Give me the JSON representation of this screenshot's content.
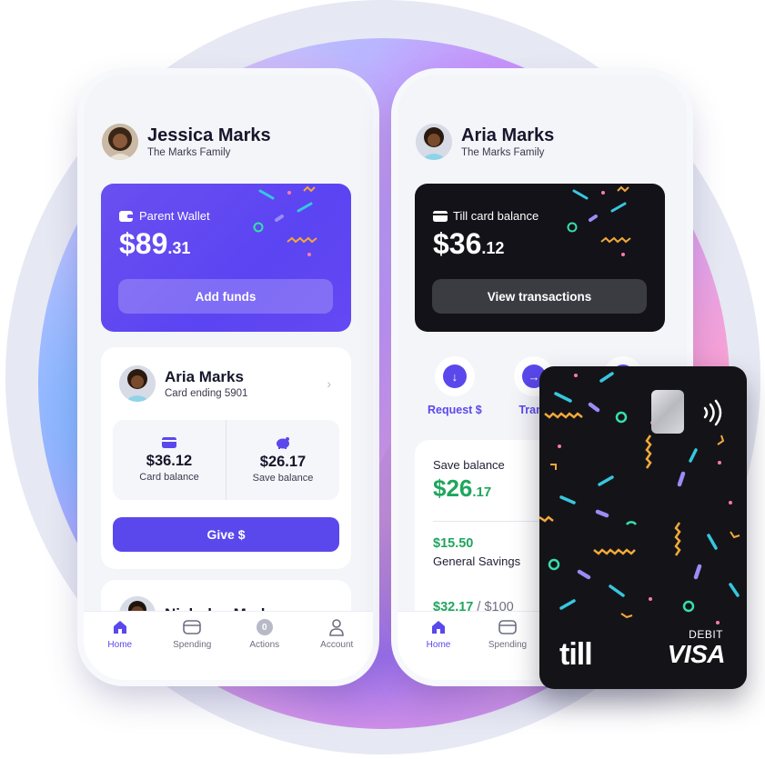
{
  "left_phone": {
    "profile": {
      "name": "Jessica Marks",
      "family": "The Marks Family"
    },
    "wallet": {
      "label": "Parent Wallet",
      "amount_whole": "$89",
      "amount_cents": ".31",
      "button": "Add funds"
    },
    "child": {
      "name": "Aria Marks",
      "subtitle": "Card ending 5901",
      "card_balance_value": "$36.12",
      "card_balance_label": "Card balance",
      "save_balance_value": "$26.17",
      "save_balance_label": "Save balance",
      "button": "Give $"
    },
    "next_child": {
      "name": "Nicholas Marks"
    },
    "tabs": [
      {
        "label": "Home",
        "icon": "home-icon"
      },
      {
        "label": "Spending",
        "icon": "card-icon"
      },
      {
        "label": "Actions",
        "icon": "badge-icon",
        "badge": "0"
      },
      {
        "label": "Account",
        "icon": "person-icon"
      }
    ]
  },
  "right_phone": {
    "profile": {
      "name": "Aria Marks",
      "family": "The Marks Family"
    },
    "wallet": {
      "label": "Till card balance",
      "amount_whole": "$36",
      "amount_cents": ".12",
      "button": "View transactions"
    },
    "actions": [
      {
        "label": "Request $",
        "icon": "arrow-down-icon"
      },
      {
        "label": "Trans",
        "icon": "arrow-right-icon"
      }
    ],
    "save": {
      "label": "Save balance",
      "amount_whole": "$26",
      "amount_cents": ".17",
      "goal_amount": "$15.50",
      "goal_name": "General Savings",
      "goal2_amount": "$32.17",
      "goal2_of": " / $100"
    },
    "tabs": [
      {
        "label": "Home",
        "icon": "home-icon"
      },
      {
        "label": "Spending",
        "icon": "card-icon"
      }
    ]
  },
  "debit_card": {
    "brand": "till",
    "type": "DEBIT",
    "network": "VISA"
  },
  "colors": {
    "accent_purple": "#5a48ec",
    "save_green": "#1fa65d",
    "card_black": "#141418"
  }
}
